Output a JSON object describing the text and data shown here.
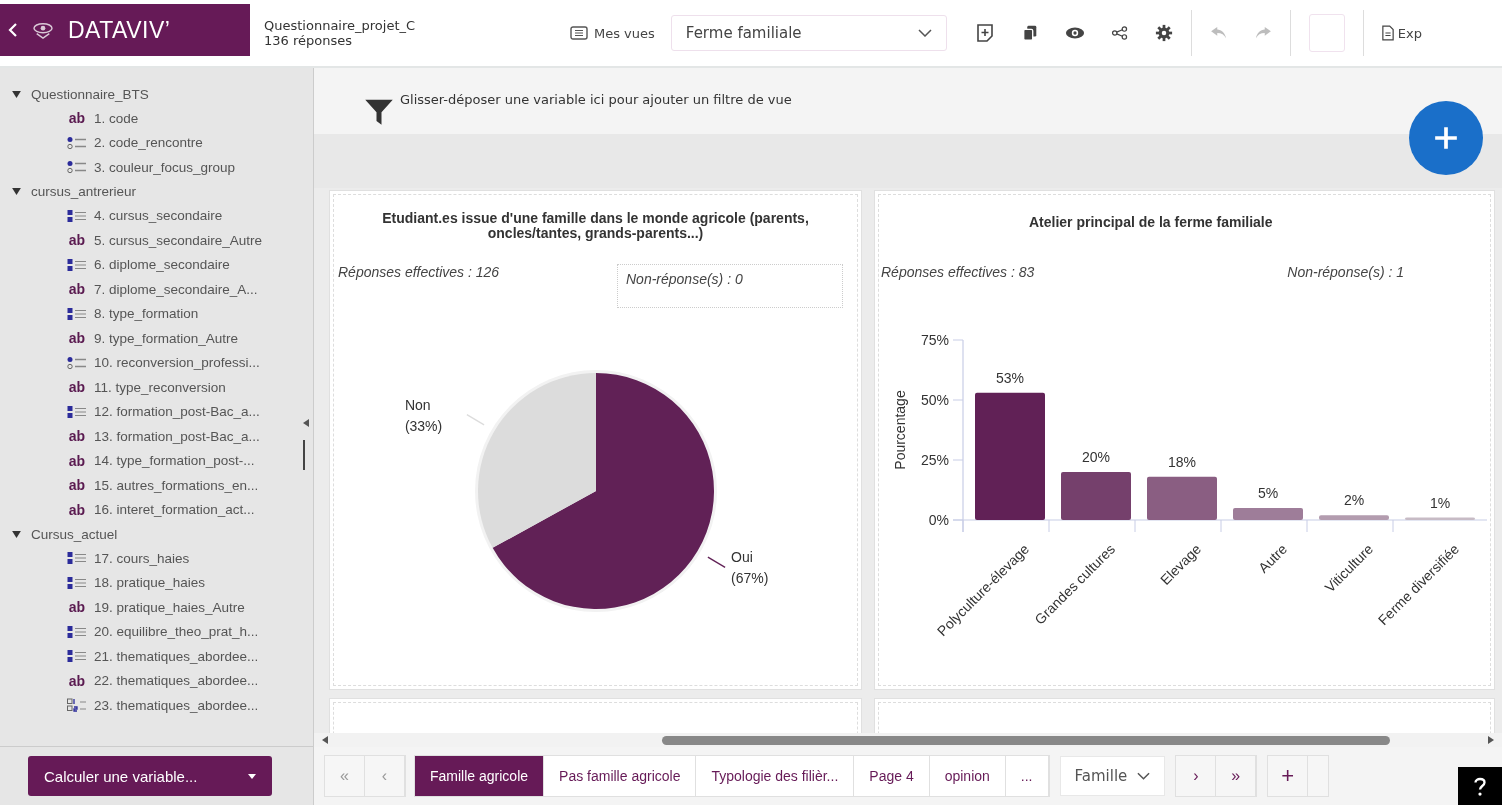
{
  "app": {
    "logo": "DATAVIV’"
  },
  "questionnaire": {
    "name": "Questionnaire_projet_C",
    "responses": "136 réponses"
  },
  "toolbar": {
    "views_button": "Mes vues",
    "view_select": "Ferme familiale",
    "undo_disabled": true,
    "redo_disabled": true,
    "export": "Exp"
  },
  "sidebar": {
    "groups": [
      {
        "label": "Questionnaire_BTS",
        "expanded": true,
        "children": [
          {
            "kind": "text",
            "badge": "ab",
            "label": "1. code"
          },
          {
            "kind": "single",
            "label": "2. code_rencontre"
          },
          {
            "kind": "single",
            "label": "3. couleur_focus_group"
          }
        ]
      },
      {
        "label": "cursus_antrerieur",
        "expanded": true,
        "children": [
          {
            "kind": "multi",
            "label": "4. cursus_secondaire"
          },
          {
            "kind": "text",
            "badge": "ab",
            "label": "5. cursus_secondaire_Autre"
          },
          {
            "kind": "multi",
            "label": "6. diplome_secondaire"
          },
          {
            "kind": "text",
            "badge": "ab",
            "label": "7. diplome_secondaire_A..."
          },
          {
            "kind": "multi",
            "label": "8. type_formation"
          },
          {
            "kind": "text",
            "badge": "ab",
            "label": "9. type_formation_Autre"
          },
          {
            "kind": "single",
            "label": "10. reconversion_professi..."
          },
          {
            "kind": "text",
            "badge": "ab",
            "label": "11. type_reconversion"
          },
          {
            "kind": "multi",
            "label": "12. formation_post-Bac_a..."
          },
          {
            "kind": "text",
            "badge": "ab",
            "label": "13. formation_post-Bac_a..."
          },
          {
            "kind": "text",
            "badge": "ab",
            "label": "14. type_formation_post-..."
          },
          {
            "kind": "text",
            "badge": "ab",
            "label": "15. autres_formations_en..."
          },
          {
            "kind": "text",
            "badge": "ab",
            "label": "16. interet_formation_act..."
          }
        ]
      },
      {
        "label": "Cursus_actuel",
        "expanded": true,
        "children": [
          {
            "kind": "multi",
            "label": "17. cours_haies"
          },
          {
            "kind": "multi",
            "label": "18. pratique_haies"
          },
          {
            "kind": "text",
            "badge": "ab",
            "label": "19. pratique_haies_Autre"
          },
          {
            "kind": "multi",
            "label": "20. equilibre_theo_prat_h..."
          },
          {
            "kind": "multi",
            "label": "21. thematiques_abordee..."
          },
          {
            "kind": "text",
            "badge": "ab",
            "label": "22. thematiques_abordee..."
          },
          {
            "kind": "ranking",
            "label": "23. thematiques_abordee..."
          }
        ]
      }
    ],
    "compute_button": "Calculer une variable..."
  },
  "filter_bar": {
    "hint": "Glisser-déposer une variable ici pour ajouter un filtre de vue"
  },
  "cards": [
    {
      "title": "Etudiant.es issue d'une famille dans le monde agricole (parents, oncles/tantes, grands-parents...)",
      "effective": "Réponses effectives : 126",
      "missing": "Non-réponse(s) : 0",
      "chart_data": {
        "type": "pie",
        "categories": [
          "Non",
          "Oui"
        ],
        "values": [
          33,
          67
        ],
        "value_labels": [
          "(33%)",
          "(67%)"
        ]
      }
    },
    {
      "title": "Atelier principal de la ferme familiale",
      "effective": "Réponses effectives : 83",
      "missing": "Non-réponse(s) : 1",
      "chart_data": {
        "type": "bar",
        "ylabel": "Pourcentage",
        "categories": [
          "Polyculture-élevage",
          "Grandes cultures",
          "Elevage",
          "Autre",
          "Viticulture",
          "Ferme diversifiée"
        ],
        "values": [
          53,
          20,
          18,
          5,
          2,
          1
        ],
        "ylim": [
          0,
          75
        ],
        "yticks": [
          {
            "value": 0,
            "label": "0%"
          },
          {
            "value": 25,
            "label": "25%"
          },
          {
            "value": 50,
            "label": "50%"
          },
          {
            "value": 75,
            "label": "75%"
          }
        ],
        "value_labels": [
          "53%",
          "20%",
          "18%",
          "5%",
          "2%",
          "1%"
        ]
      }
    }
  ],
  "pages": {
    "tabs": [
      {
        "label": "Famille agricole",
        "selected": true
      },
      {
        "label": "Pas famille agricole",
        "selected": false
      },
      {
        "label": "Typologie des filièr...",
        "selected": false
      },
      {
        "label": "Page 4",
        "selected": false
      },
      {
        "label": "opinion",
        "selected": false
      },
      {
        "label": "...",
        "selected": false
      }
    ],
    "first": "«",
    "prev": "‹",
    "next": "›",
    "last": "»",
    "add": "+",
    "page_select": "Famille"
  }
}
